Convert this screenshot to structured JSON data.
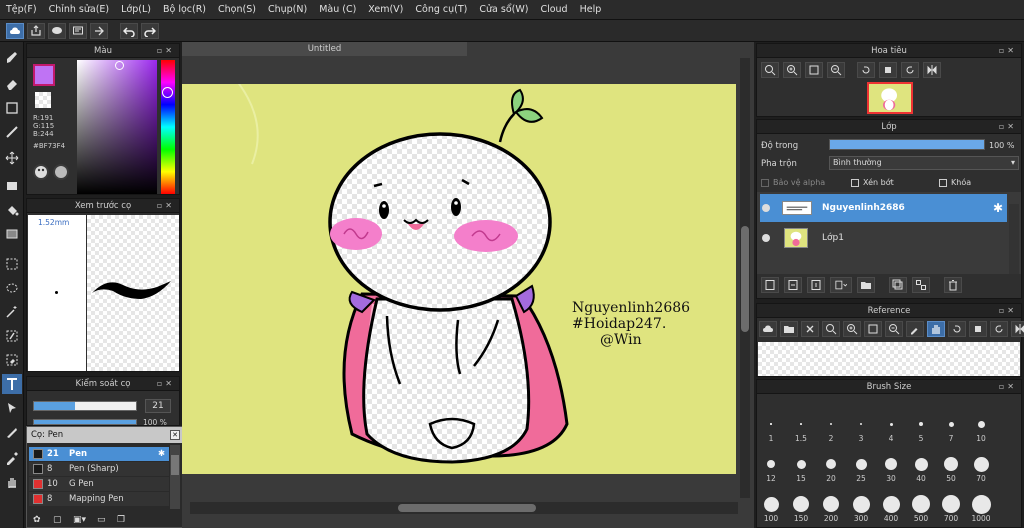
{
  "menu": [
    "Tệp(F)",
    "Chỉnh sửa(E)",
    "Lớp(L)",
    "Bộ lọc(R)",
    "Chọn(S)",
    "Chụp(N)",
    "Màu (C)",
    "Xem(V)",
    "Công cụ(T)",
    "Cửa sổ(W)",
    "Cloud",
    "Help"
  ],
  "document": {
    "title": "Untitled"
  },
  "color_panel": {
    "title": "Màu",
    "r": "R:191",
    "g": "G:115",
    "b": "B:244",
    "hex": "#BF73F4",
    "current_color": "#BF73F4"
  },
  "brush_preview": {
    "title": "Xem trước cọ",
    "size": "1.52mm"
  },
  "brush_control": {
    "title": "Kiểm soát cọ",
    "size_value": "21",
    "opacity_value": "100 %"
  },
  "brush_list": {
    "title": "Cọ: Pen",
    "items": [
      {
        "size": "21",
        "name": "Pen",
        "color": "#1a1a1a"
      },
      {
        "size": "8",
        "name": "Pen (Sharp)",
        "color": "#1a1a1a"
      },
      {
        "size": "10",
        "name": "G Pen",
        "color": "#e03030"
      },
      {
        "size": "8",
        "name": "Mapping Pen",
        "color": "#e03030"
      }
    ]
  },
  "navigator": {
    "title": "Hoa tiêu"
  },
  "layer_panel": {
    "title": "Lớp",
    "opacity_label": "Độ trong",
    "opacity_value": "100 %",
    "blend_label": "Pha trộn",
    "blend_value": "Bình thường",
    "protect_alpha": "Bảo vệ alpha",
    "clipping": "Xén bớt",
    "lock": "Khóa",
    "layers": [
      {
        "name": "Nguyenlinh2686"
      },
      {
        "name": "Lớp1"
      }
    ]
  },
  "reference": {
    "title": "Reference"
  },
  "brush_size": {
    "title": "Brush Size",
    "sizes": [
      "1",
      "1.5",
      "2",
      "3",
      "4",
      "5",
      "7",
      "10",
      "12",
      "15",
      "20",
      "25",
      "30",
      "40",
      "50",
      "70",
      "100",
      "150",
      "200",
      "300",
      "400",
      "500",
      "700",
      "1000"
    ]
  },
  "watermark": {
    "line1": "Nguyenlinh2686",
    "line2": "#Hoidap247.",
    "line3": "@Win"
  }
}
